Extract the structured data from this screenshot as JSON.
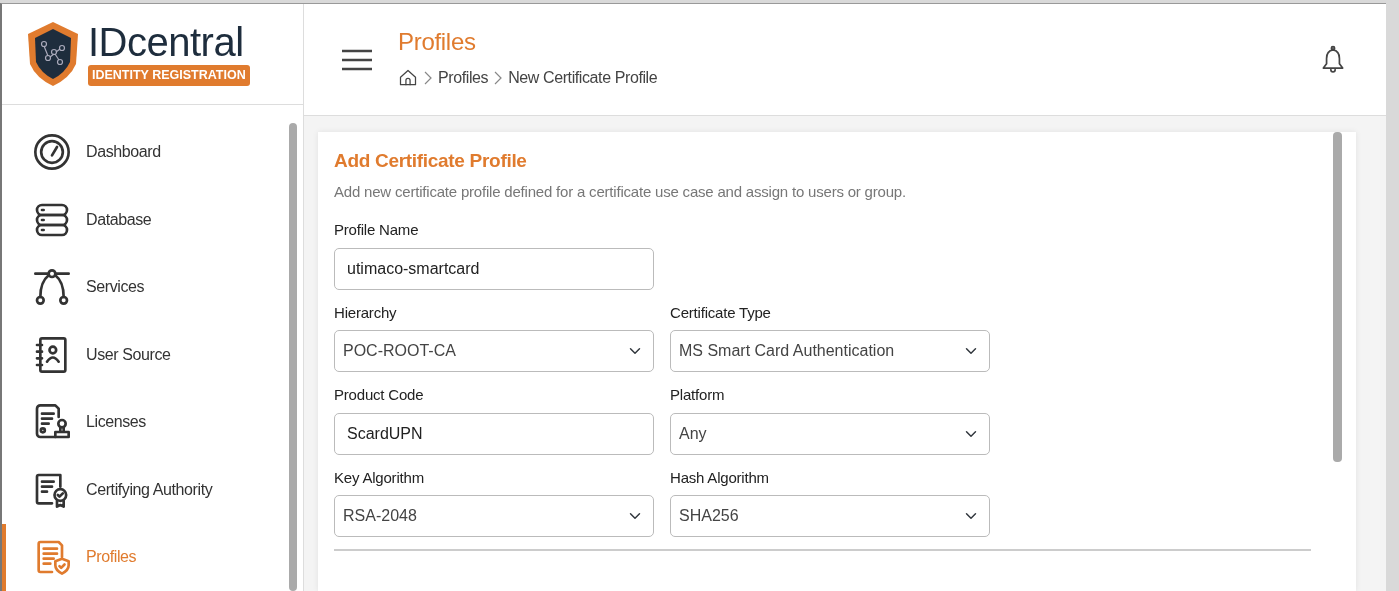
{
  "logo": {
    "name": "IDcentral",
    "tagline": "IDENTITY REGISTRATION"
  },
  "header": {
    "title": "Profiles",
    "breadcrumb": [
      "Profiles",
      "New Certificate Profile"
    ]
  },
  "sidebar": {
    "items": [
      {
        "label": "Dashboard",
        "selected": false
      },
      {
        "label": "Database",
        "selected": false
      },
      {
        "label": "Services",
        "selected": false
      },
      {
        "label": "User Source",
        "selected": false
      },
      {
        "label": "Licenses",
        "selected": false
      },
      {
        "label": "Certifying Authority",
        "selected": false
      },
      {
        "label": "Profiles",
        "selected": true
      }
    ]
  },
  "form": {
    "title": "Add Certificate Profile",
    "description": "Add new certificate profile defined for a certificate use case and assign to users or group.",
    "rows": [
      [
        {
          "label": "Profile Name",
          "kind": "text",
          "value": "utimaco-smartcard"
        }
      ],
      [
        {
          "label": "Hierarchy",
          "kind": "select",
          "value": "POC-ROOT-CA"
        },
        {
          "label": "Certificate Type",
          "kind": "select",
          "value": "MS Smart Card Authentication"
        }
      ],
      [
        {
          "label": "Product Code",
          "kind": "text",
          "value": "ScardUPN"
        },
        {
          "label": "Platform",
          "kind": "select",
          "value": "Any"
        }
      ],
      [
        {
          "label": "Key Algorithm",
          "kind": "select",
          "value": "RSA-2048"
        },
        {
          "label": "Hash Algorithm",
          "kind": "select",
          "value": "SHA256"
        }
      ]
    ]
  }
}
